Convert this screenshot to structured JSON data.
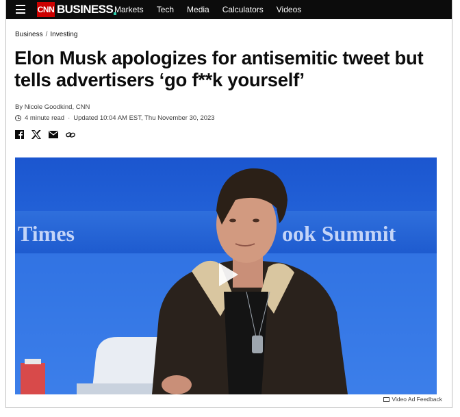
{
  "header": {
    "logo_cnn": "CNN",
    "logo_business": "BUSINESS",
    "nav": [
      "Markets",
      "Tech",
      "Media",
      "Calculators",
      "Videos"
    ]
  },
  "breadcrumb": {
    "items": [
      "Business",
      "Investing"
    ],
    "separator": "/"
  },
  "article": {
    "headline": "Elon Musk apologizes for antisemitic tweet but tells advertisers ‘go f**k yourself’",
    "byline_prefix": "By ",
    "author": "Nicole Goodkind, CNN",
    "read_time": "4 minute read",
    "updated": "Updated 10:04 AM EST, Thu November 30, 2023"
  },
  "share": {
    "icons": [
      "facebook-icon",
      "x-icon",
      "email-icon",
      "link-icon"
    ]
  },
  "video": {
    "backdrop_left_text": "Times",
    "backdrop_right_text": "ook Summit",
    "feedback_label": "Video Ad Feedback"
  },
  "colors": {
    "brand_red": "#cc0000",
    "header_bg": "#0c0c0c",
    "accent_teal": "#2bd1b0",
    "stage_blue": "#1f5fd6"
  }
}
